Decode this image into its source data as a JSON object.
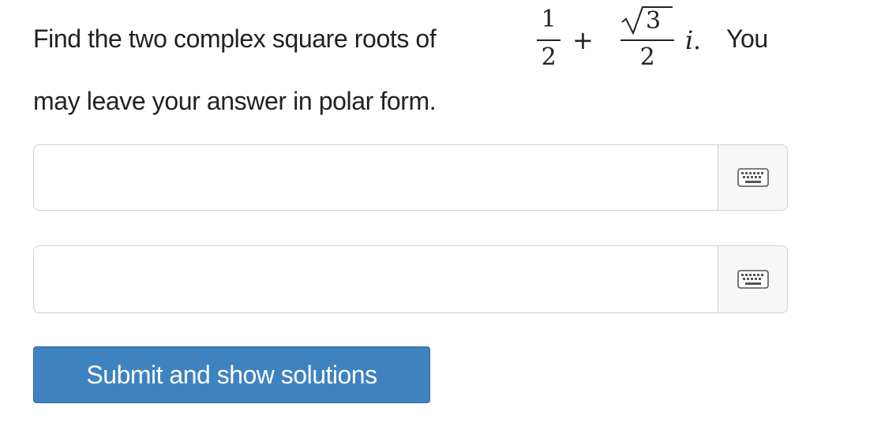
{
  "question": {
    "text_before_math": "Find the two complex square roots of",
    "math": {
      "real_numerator": "1",
      "real_denominator": "2",
      "operator": "+",
      "imag_radicand": "3",
      "imag_denominator": "2",
      "imag_unit": "i",
      "trailing_period": "."
    },
    "text_after_math": "You",
    "line2": "may leave your answer in polar form."
  },
  "answers": [
    {
      "value": "",
      "placeholder": "",
      "keyboard_icon": "keyboard-icon"
    },
    {
      "value": "",
      "placeholder": "",
      "keyboard_icon": "keyboard-icon"
    }
  ],
  "submit": {
    "label": "Submit and show solutions",
    "color": "#3f82c0"
  }
}
